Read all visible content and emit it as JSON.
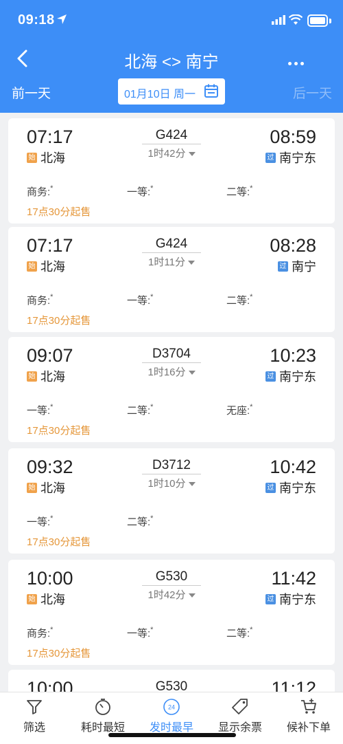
{
  "status": {
    "time": "09:18"
  },
  "nav": {
    "title": "北海 <> 南宁"
  },
  "datebar": {
    "prev": "前一天",
    "date": "01月10日 周一",
    "next": "后一天"
  },
  "trains": [
    {
      "dep_time": "07:17",
      "train_no": "G424",
      "duration": "1时42分",
      "arr_time": "08:59",
      "dep_station": "北海",
      "dep_tag": "始",
      "arr_station": "南宁东",
      "arr_tag": "过",
      "seats": [
        "商务:",
        "一等:",
        "二等:"
      ],
      "seat_mark": "*",
      "sale": "17点30分起售"
    },
    {
      "dep_time": "07:17",
      "train_no": "G424",
      "duration": "1时11分",
      "arr_time": "08:28",
      "dep_station": "北海",
      "dep_tag": "始",
      "arr_station": "南宁",
      "arr_tag": "过",
      "seats": [
        "商务:",
        "一等:",
        "二等:"
      ],
      "seat_mark": "*",
      "sale": "17点30分起售"
    },
    {
      "dep_time": "09:07",
      "train_no": "D3704",
      "duration": "1时16分",
      "arr_time": "10:23",
      "dep_station": "北海",
      "dep_tag": "始",
      "arr_station": "南宁东",
      "arr_tag": "过",
      "seats": [
        "一等:",
        "二等:",
        "无座:"
      ],
      "seat_mark": "*",
      "sale": "17点30分起售"
    },
    {
      "dep_time": "09:32",
      "train_no": "D3712",
      "duration": "1时10分",
      "arr_time": "10:42",
      "dep_station": "北海",
      "dep_tag": "始",
      "arr_station": "南宁东",
      "arr_tag": "过",
      "seats": [
        "一等:",
        "二等:"
      ],
      "seat_mark": "*",
      "sale": "17点30分起售"
    },
    {
      "dep_time": "10:00",
      "train_no": "G530",
      "duration": "1时42分",
      "arr_time": "11:42",
      "dep_station": "北海",
      "dep_tag": "始",
      "arr_station": "南宁东",
      "arr_tag": "过",
      "seats": [
        "商务:",
        "一等:",
        "二等:"
      ],
      "seat_mark": "*",
      "sale": "17点30分起售"
    },
    {
      "dep_time": "10:00",
      "train_no": "G530",
      "arr_time": "11:12"
    }
  ],
  "tabs": [
    {
      "label": "筛选",
      "icon": "filter-icon"
    },
    {
      "label": "耗时最短",
      "icon": "stopwatch-icon"
    },
    {
      "label": "发时最早",
      "icon": "clock-24-icon"
    },
    {
      "label": "显示余票",
      "icon": "tag-icon"
    },
    {
      "label": "候补下单",
      "icon": "cart-icon"
    }
  ],
  "colors": {
    "primary": "#3d8ef7",
    "sale": "#e5973a",
    "start_tag": "#f0a24b",
    "pass_tag": "#4a90e2"
  }
}
